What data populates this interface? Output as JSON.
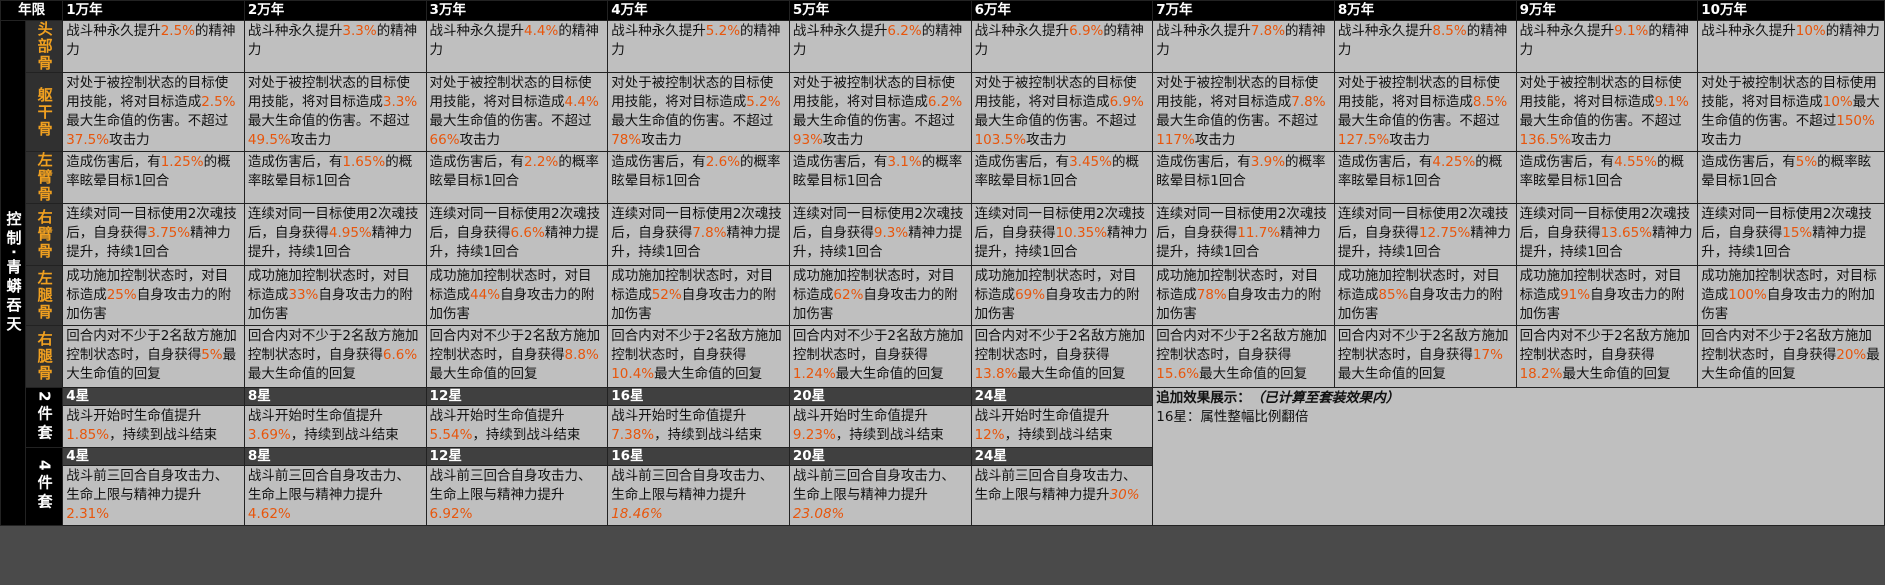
{
  "header": {
    "corner": "年限",
    "years": [
      "1万年",
      "2万年",
      "3万年",
      "4万年",
      "5万年",
      "6万年",
      "7万年",
      "8万年",
      "9万年",
      "10万年"
    ]
  },
  "side_label": "控制·青蟒吞天",
  "parts": [
    {
      "name": "头部骨",
      "cells": [
        [
          "战斗种永久提升",
          "2.5%",
          "的精神力"
        ],
        [
          "战斗种永久提升",
          "3.3%",
          "的精神力"
        ],
        [
          "战斗种永久提升",
          "4.4%",
          "的精神力"
        ],
        [
          "战斗种永久提升",
          "5.2%",
          "的精神力"
        ],
        [
          "战斗种永久提升",
          "6.2%",
          "的精神力"
        ],
        [
          "战斗种永久提升",
          "6.9%",
          "的精神力"
        ],
        [
          "战斗种永久提升",
          "7.8%",
          "的精神力"
        ],
        [
          "战斗种永久提升",
          "8.5%",
          "的精神力"
        ],
        [
          "战斗种永久提升",
          "9.1%",
          "的精神力"
        ],
        [
          "战斗种永久提升",
          "10%",
          "的精神力"
        ]
      ]
    },
    {
      "name": "躯干骨",
      "cells": [
        [
          "对处于被控制状态的目标使用技能，将对目标造成",
          "2.5%",
          "最大生命值的伤害。不超过",
          "37.5%",
          "攻击力"
        ],
        [
          "对处于被控制状态的目标使用技能，将对目标造成",
          "3.3%",
          "最大生命值的伤害。不超过",
          "49.5%",
          "攻击力"
        ],
        [
          "对处于被控制状态的目标使用技能，将对目标造成",
          "4.4%",
          "最大生命值的伤害。不超过",
          "66%",
          "攻击力"
        ],
        [
          "对处于被控制状态的目标使用技能，将对目标造成",
          "5.2%",
          "最大生命值的伤害。不超过",
          "78%",
          "攻击力"
        ],
        [
          "对处于被控制状态的目标使用技能，将对目标造成",
          "6.2%",
          "最大生命值的伤害。不超过",
          "93%",
          "攻击力"
        ],
        [
          "对处于被控制状态的目标使用技能，将对目标造成",
          "6.9%",
          "最大生命值的伤害。不超过",
          "103.5%",
          "攻击力"
        ],
        [
          "对处于被控制状态的目标使用技能，将对目标造成",
          "7.8%",
          "最大生命值的伤害。不超过",
          "117%",
          "攻击力"
        ],
        [
          "对处于被控制状态的目标使用技能，将对目标造成",
          "8.5%",
          "最大生命值的伤害。不超过",
          "127.5%",
          "攻击力"
        ],
        [
          "对处于被控制状态的目标使用技能，将对目标造成",
          "9.1%",
          "最大生命值的伤害。不超过",
          "136.5%",
          "攻击力"
        ],
        [
          "对处于被控制状态的目标使用技能，将对目标造成",
          "10%",
          "最大生命值的伤害。不超过",
          "150%",
          "攻击力"
        ]
      ]
    },
    {
      "name": "左臂骨",
      "cells": [
        [
          "造成伤害后，有",
          "1.25%",
          "的概率眩晕目标1回合"
        ],
        [
          "造成伤害后，有",
          "1.65%",
          "的概率眩晕目标1回合"
        ],
        [
          "造成伤害后，有",
          "2.2%",
          "的概率眩晕目标1回合"
        ],
        [
          "造成伤害后，有",
          "2.6%",
          "的概率眩晕目标1回合"
        ],
        [
          "造成伤害后，有",
          "3.1%",
          "的概率眩晕目标1回合"
        ],
        [
          "造成伤害后，有",
          "3.45%",
          "的概率眩晕目标1回合"
        ],
        [
          "造成伤害后，有",
          "3.9%",
          "的概率眩晕目标1回合"
        ],
        [
          "造成伤害后，有",
          "4.25%",
          "的概率眩晕目标1回合"
        ],
        [
          "造成伤害后，有",
          "4.55%",
          "的概率眩晕目标1回合"
        ],
        [
          "造成伤害后，有",
          "5%",
          "的概率眩晕目标1回合"
        ]
      ]
    },
    {
      "name": "右臂骨",
      "cells": [
        [
          "连续对同一目标使用2次魂技后，自身获得",
          "3.75%",
          "精神力提升，持续1回合"
        ],
        [
          "连续对同一目标使用2次魂技后，自身获得",
          "4.95%",
          "精神力提升，持续1回合"
        ],
        [
          "连续对同一目标使用2次魂技后，自身获得",
          "6.6%",
          "精神力提升，持续1回合"
        ],
        [
          "连续对同一目标使用2次魂技后，自身获得",
          "7.8%",
          "精神力提升，持续1回合"
        ],
        [
          "连续对同一目标使用2次魂技后，自身获得",
          "9.3%",
          "精神力提升，持续1回合"
        ],
        [
          "连续对同一目标使用2次魂技后，自身获得",
          "10.35%",
          "精神力提升，持续1回合"
        ],
        [
          "连续对同一目标使用2次魂技后，自身获得",
          "11.7%",
          "精神力提升，持续1回合"
        ],
        [
          "连续对同一目标使用2次魂技后，自身获得",
          "12.75%",
          "精神力提升，持续1回合"
        ],
        [
          "连续对同一目标使用2次魂技后，自身获得",
          "13.65%",
          "精神力提升，持续1回合"
        ],
        [
          "连续对同一目标使用2次魂技后，自身获得",
          "15%",
          "精神力提升，持续1回合"
        ]
      ]
    },
    {
      "name": "左腿骨",
      "cells": [
        [
          "成功施加控制状态时，对目标造成",
          "25%",
          "自身攻击力的附加伤害"
        ],
        [
          "成功施加控制状态时，对目标造成",
          "33%",
          "自身攻击力的附加伤害"
        ],
        [
          "成功施加控制状态时，对目标造成",
          "44%",
          "自身攻击力的附加伤害"
        ],
        [
          "成功施加控制状态时，对目标造成",
          "52%",
          "自身攻击力的附加伤害"
        ],
        [
          "成功施加控制状态时，对目标造成",
          "62%",
          "自身攻击力的附加伤害"
        ],
        [
          "成功施加控制状态时，对目标造成",
          "69%",
          "自身攻击力的附加伤害"
        ],
        [
          "成功施加控制状态时，对目标造成",
          "78%",
          "自身攻击力的附加伤害"
        ],
        [
          "成功施加控制状态时，对目标造成",
          "85%",
          "自身攻击力的附加伤害"
        ],
        [
          "成功施加控制状态时，对目标造成",
          "91%",
          "自身攻击力的附加伤害"
        ],
        [
          "成功施加控制状态时，对目标造成",
          "100%",
          "自身攻击力的附加伤害"
        ]
      ]
    },
    {
      "name": "右腿骨",
      "cells": [
        [
          "回合内对不少于2名敌方施加控制状态时，自身获得",
          "5%",
          "最大生命值的回复"
        ],
        [
          "回合内对不少于2名敌方施加控制状态时，自身获得",
          "6.6%",
          "最大生命值的回复"
        ],
        [
          "回合内对不少于2名敌方施加控制状态时，自身获得",
          "8.8%",
          "最大生命值的回复"
        ],
        [
          "回合内对不少于2名敌方施加控制状态时，自身获得",
          "10.4%",
          "最大生命值的回复"
        ],
        [
          "回合内对不少于2名敌方施加控制状态时，自身获得",
          "1.24%",
          "最大生命值的回复"
        ],
        [
          "回合内对不少于2名敌方施加控制状态时，自身获得",
          "13.8%",
          "最大生命值的回复"
        ],
        [
          "回合内对不少于2名敌方施加控制状态时，自身获得",
          "15.6%",
          "最大生命值的回复"
        ],
        [
          "回合内对不少于2名敌方施加控制状态时，自身获得",
          "17%",
          "最大生命值的回复"
        ],
        [
          "回合内对不少于2名敌方施加控制状态时，自身获得",
          "18.2%",
          "最大生命值的回复"
        ],
        [
          "回合内对不少于2名敌方施加控制状态时，自身获得",
          "20%",
          "最大生命值的回复"
        ]
      ]
    }
  ],
  "set2": {
    "label": "2件套",
    "stars": [
      "4星",
      "8星",
      "12星",
      "16星",
      "20星",
      "24星"
    ],
    "cells": [
      [
        "战斗开始时生命值提升",
        "1.85%",
        "，持续到战斗结束"
      ],
      [
        "战斗开始时生命值提升",
        "3.69%",
        "，持续到战斗结束"
      ],
      [
        "战斗开始时生命值提升",
        "5.54%",
        "，持续到战斗结束"
      ],
      [
        "战斗开始时生命值提升",
        "7.38%",
        "，持续到战斗结束"
      ],
      [
        "战斗开始时生命值提升",
        "9.23%",
        "，持续到战斗结束"
      ],
      [
        "战斗开始时生命值提升",
        "12%",
        "，持续到战斗结束"
      ]
    ],
    "note_title": "追加效果展示：",
    "note_title_em": "（已计算至套装效果内）",
    "note_line": "16星：属性整幅比例翻倍"
  },
  "set4": {
    "label": "4件套",
    "stars": [
      "4星",
      "8星",
      "12星",
      "16星",
      "20星",
      "24星"
    ],
    "cells": [
      [
        "战斗前三回合自身攻击力、生命上限与精神力提升",
        "2.31%"
      ],
      [
        "战斗前三回合自身攻击力、生命上限与精神力提升",
        "4.62%"
      ],
      [
        "战斗前三回合自身攻击力、生命上限与精神力提升",
        "6.92%"
      ],
      [
        "战斗前三回合自身攻击力、生命上限与精神力提升",
        "18.46%"
      ],
      [
        "战斗前三回合自身攻击力、生命上限与精神力提升",
        "23.08%"
      ],
      [
        "战斗前三回合自身攻击力、生命上限与精神力提升",
        "30%"
      ]
    ],
    "italic_flags": [
      false,
      false,
      false,
      true,
      true,
      true
    ]
  },
  "colors": {
    "highlight": "#e8560c",
    "cell_bg": "#bfbfbf",
    "header_bg": "#000000",
    "part_label": "#f0a020"
  }
}
